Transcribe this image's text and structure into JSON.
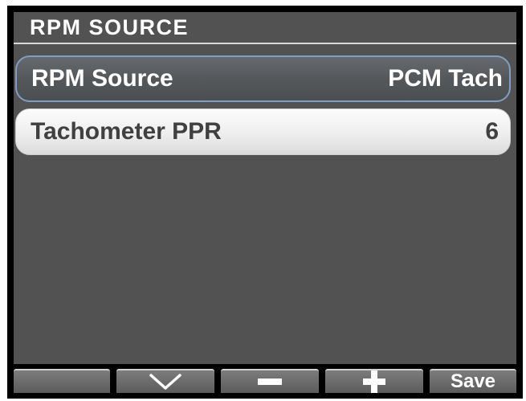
{
  "header": {
    "title": "RPM SOURCE"
  },
  "settings": [
    {
      "label": "RPM Source",
      "value": "PCM Tach"
    },
    {
      "label": "Tachometer PPR",
      "value": "6"
    }
  ],
  "softkeys": {
    "blank": "",
    "down_icon": "chevron-down-icon",
    "minus_icon": "minus-icon",
    "plus_icon": "plus-icon",
    "save_label": "Save"
  },
  "colors": {
    "background": "#525252",
    "selected_border": "#7e9fc4",
    "row_text_dark": "#404040",
    "text_light": "#ffffff"
  }
}
